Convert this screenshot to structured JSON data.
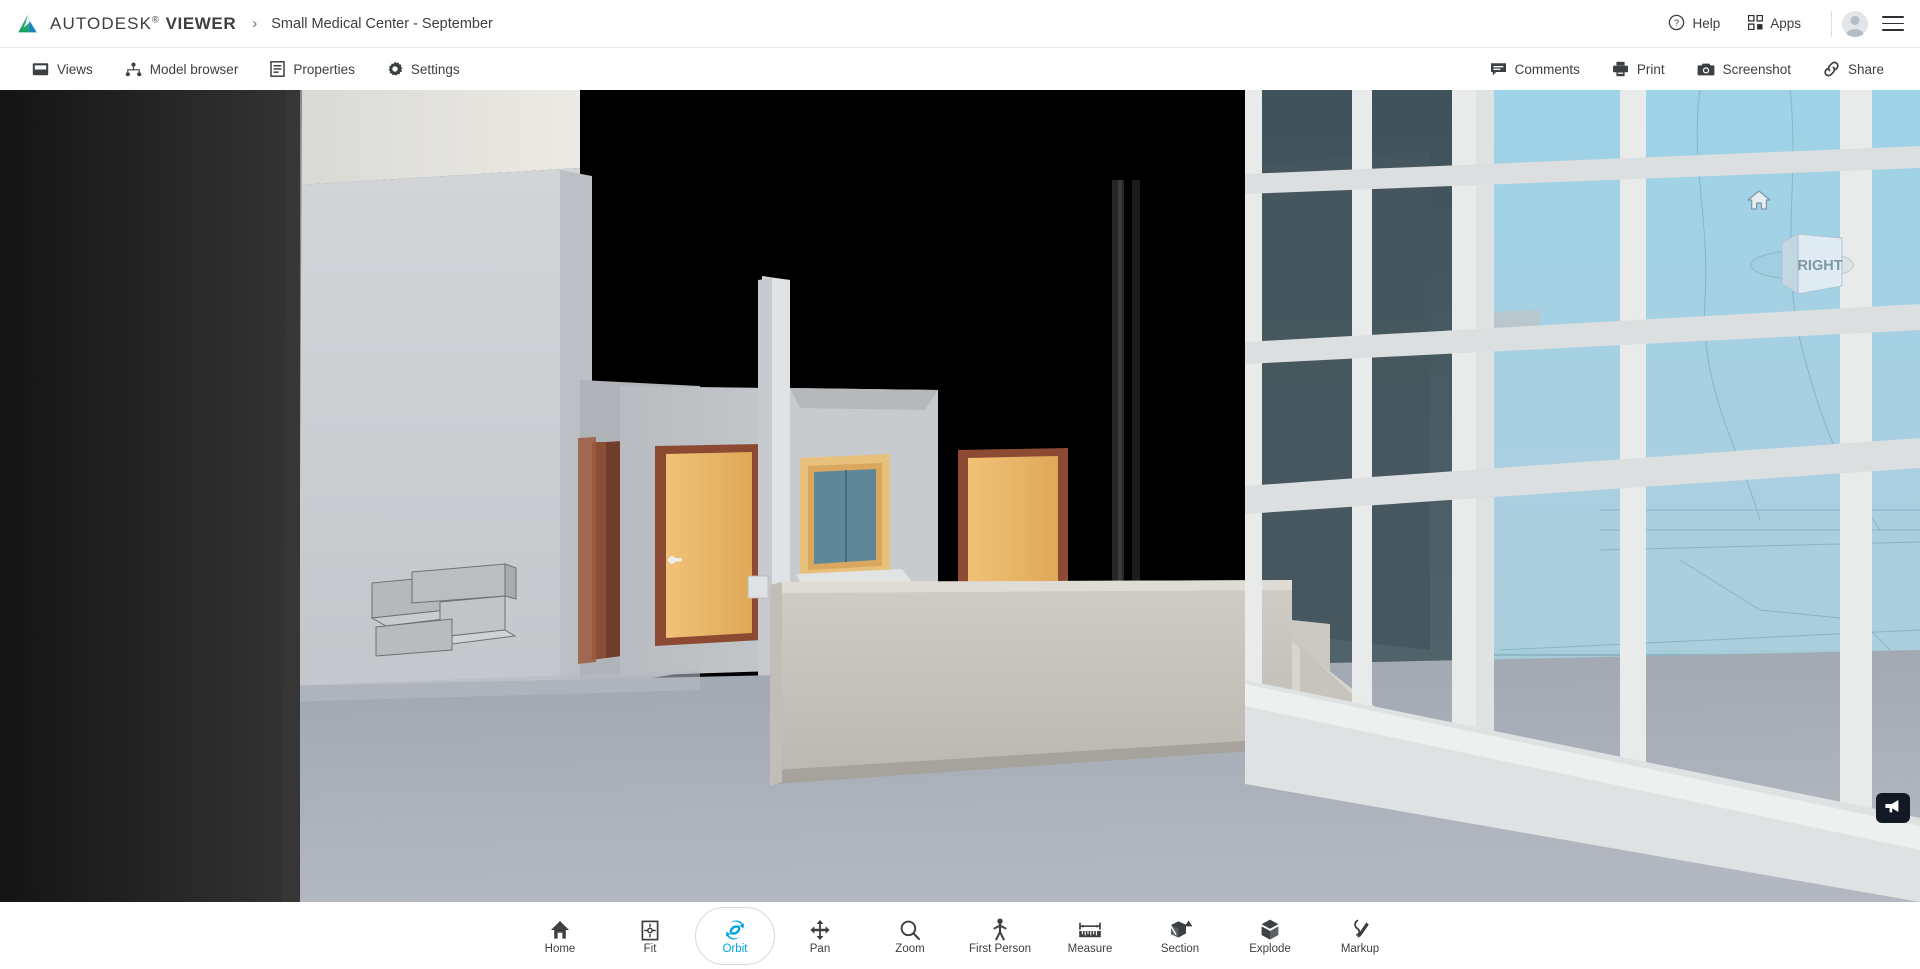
{
  "header": {
    "logo_icon": "autodesk-logo-icon",
    "brand_primary": "AUTODESK",
    "brand_sup": "®",
    "brand_secondary": "VIEWER",
    "breadcrumb_separator": "›",
    "breadcrumb_title": "Small Medical Center - September",
    "help_label": "Help",
    "help_icon": "question-circle-icon",
    "apps_label": "Apps",
    "apps_icon": "grid-apps-icon",
    "avatar_icon": "user-avatar-icon",
    "menu_icon": "hamburger-menu-icon"
  },
  "toolbar": {
    "left_items": [
      {
        "label": "Views",
        "icon": "views-panel-icon"
      },
      {
        "label": "Model browser",
        "icon": "model-tree-icon"
      },
      {
        "label": "Properties",
        "icon": "properties-list-icon"
      },
      {
        "label": "Settings",
        "icon": "gear-icon"
      }
    ],
    "right_items": [
      {
        "label": "Comments",
        "icon": "comment-bubble-icon"
      },
      {
        "label": "Print",
        "icon": "printer-icon"
      },
      {
        "label": "Screenshot",
        "icon": "camera-icon"
      },
      {
        "label": "Share",
        "icon": "link-chain-icon"
      }
    ]
  },
  "bottom_toolbar": {
    "active_tool": "Orbit",
    "items": [
      {
        "label": "Home",
        "icon": "home-icon",
        "active": false
      },
      {
        "label": "Fit",
        "icon": "fit-to-view-icon",
        "active": false
      },
      {
        "label": "Orbit",
        "icon": "orbit-icon",
        "active": true
      },
      {
        "label": "Pan",
        "icon": "pan-arrows-icon",
        "active": false
      },
      {
        "label": "Zoom",
        "icon": "magnifier-icon",
        "active": false
      },
      {
        "label": "First Person",
        "icon": "person-walk-icon",
        "active": false
      },
      {
        "label": "Measure",
        "icon": "ruler-icon",
        "active": false
      },
      {
        "label": "Section",
        "icon": "section-cube-icon",
        "active": false
      },
      {
        "label": "Explode",
        "icon": "explode-cube-icon",
        "active": false
      },
      {
        "label": "Markup",
        "icon": "pencil-markup-icon",
        "active": false
      }
    ]
  },
  "viewcube": {
    "face_label": "RIGHT",
    "home_icon": "viewcube-home-icon"
  },
  "announcement": {
    "icon": "megaphone-icon"
  },
  "colors": {
    "accent": "#00a5e0",
    "text": "#3c4043",
    "toolbar_bg": "#ffffff",
    "viewport_void": "#000000",
    "floor": "#a9aeb8",
    "wall": "#c8cbce",
    "door": "#e7b25f",
    "door_frame": "#8c4a33",
    "glass_light": "#a8d7ea",
    "glass_dark": "#46565e",
    "mullion": "#e8eaea",
    "dark_wall": "#1b1b1b"
  },
  "scene": {
    "description": "3D interior view of a small medical center lobby",
    "elements": [
      "dark foreground wall at left",
      "light gray interior walls",
      "wall-mounted shelf unit",
      "orange wood doors with brown frames",
      "reception window with teal glass",
      "reception desk counter",
      "glass curtain wall with white mullions",
      "gray floor slab",
      "black void ceiling"
    ]
  }
}
